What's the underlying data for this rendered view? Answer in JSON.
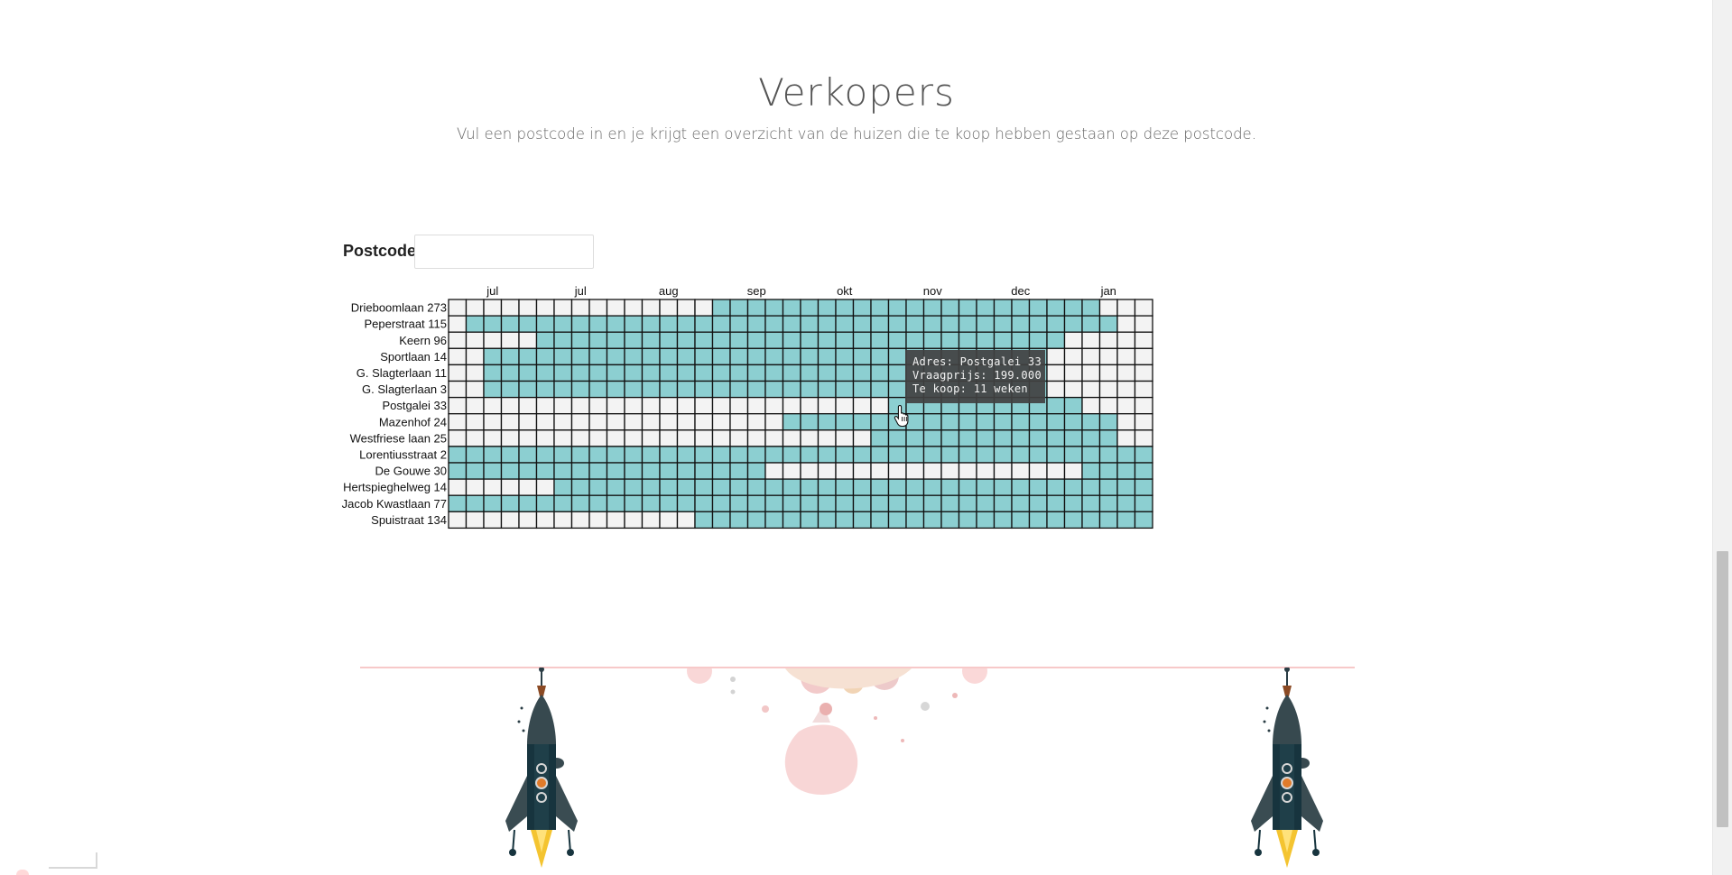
{
  "header": {
    "title": "Verkopers",
    "subtitle": "Vul een postcode in en je krijgt een overzicht van de huizen die te koop hebben gestaan op deze postcode."
  },
  "form": {
    "postcode_label": "Postcode:",
    "postcode_value": "",
    "postcode_placeholder": ""
  },
  "chart_data": {
    "type": "heatmap",
    "weeks": 40,
    "x_tick_labels": [
      "jul",
      "jul",
      "aug",
      "sep",
      "okt",
      "nov",
      "dec",
      "jan"
    ],
    "x_tick_week_index": [
      2,
      7,
      12,
      17,
      22,
      27,
      32,
      37
    ],
    "rows": [
      {
        "label": "Drieboomlaan 273",
        "for_sale_weeks": [
          [
            15,
            36
          ]
        ]
      },
      {
        "label": "Peperstraat 115",
        "for_sale_weeks": [
          [
            1,
            37
          ]
        ]
      },
      {
        "label": "Keern 96",
        "for_sale_weeks": [
          [
            5,
            34
          ]
        ]
      },
      {
        "label": "Sportlaan 14",
        "for_sale_weeks": [
          [
            2,
            33
          ]
        ]
      },
      {
        "label": "G. Slagterlaan 11",
        "for_sale_weeks": [
          [
            2,
            33
          ]
        ]
      },
      {
        "label": "G. Slagterlaan 3",
        "for_sale_weeks": [
          [
            2,
            33
          ]
        ]
      },
      {
        "label": "Postgalei 33",
        "for_sale_weeks": [
          [
            25,
            35
          ]
        ]
      },
      {
        "label": "Mazenhof 24",
        "for_sale_weeks": [
          [
            19,
            37
          ]
        ]
      },
      {
        "label": "Westfriese laan 25",
        "for_sale_weeks": [
          [
            24,
            37
          ]
        ]
      },
      {
        "label": "Lorentiusstraat 2",
        "for_sale_weeks": [
          [
            0,
            39
          ]
        ]
      },
      {
        "label": "De Gouwe 30",
        "for_sale_weeks": [
          [
            0,
            17
          ],
          [
            36,
            39
          ]
        ]
      },
      {
        "label": "Hertspieghelweg 14",
        "for_sale_weeks": [
          [
            6,
            39
          ]
        ]
      },
      {
        "label": "Jacob Kwastlaan 77",
        "for_sale_weeks": [
          [
            0,
            39
          ]
        ]
      },
      {
        "label": "Spuistraat 134",
        "for_sale_weeks": [
          [
            14,
            39
          ]
        ]
      }
    ],
    "colors": {
      "for_sale": "#8ccfd1",
      "not_for_sale": "#f3f3f3",
      "grid": "#111111"
    },
    "grid": true,
    "legend": "none"
  },
  "tooltip": {
    "address": "Adres: Postgalei 33",
    "price": "Vraagprijs: 199.000",
    "duration": "Te koop: 11 weken"
  },
  "footer": {
    "line_color": "#f7c9c9",
    "illustrations": [
      "rocket-icon",
      "rocket-icon",
      "hourglass-art"
    ]
  }
}
